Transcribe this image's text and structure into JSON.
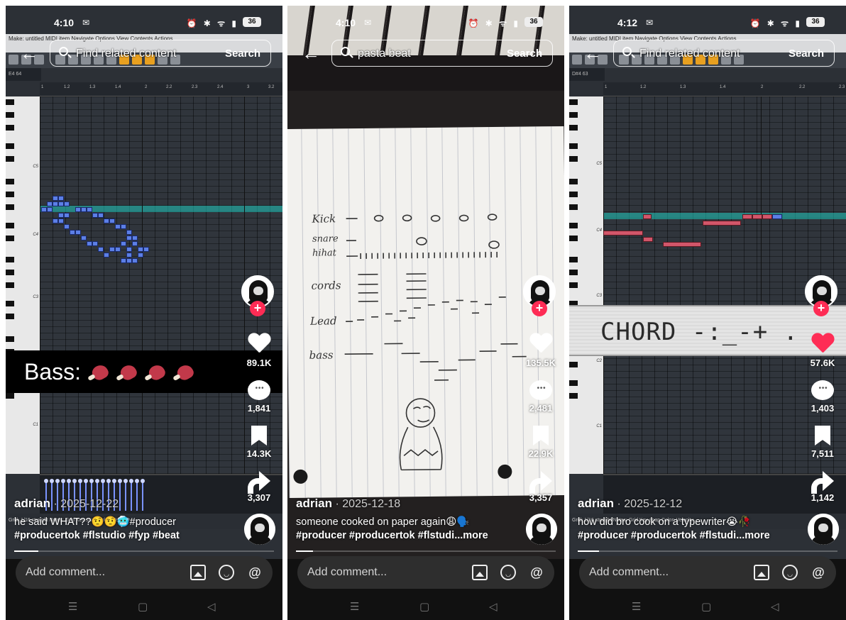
{
  "status_bar": [
    {
      "time": "4:10",
      "battery": "36"
    },
    {
      "time": "4:10",
      "battery": "36"
    },
    {
      "time": "4:12",
      "battery": "36"
    }
  ],
  "search": {
    "button_label": "Search",
    "queries": [
      "Find related content",
      "pasta beat",
      "Find related content"
    ]
  },
  "comment_bar": {
    "placeholder": "Add comment..."
  },
  "panel_1": {
    "app_menu": "Make: untitled MIDI item   Navigate   Options   View   Contents   Actions",
    "key_readout": "E4 64",
    "overlay_text": "Bass:",
    "likes": "89.1K",
    "comments": "1,841",
    "saves": "14.3K",
    "shares": "3,307",
    "username": "adrian",
    "date": "2025-12-22",
    "caption": "he said WHAT??🤨🤨🥶#producer",
    "tags": "#producertok #flstudio #fyp #beat",
    "status_text": "Grid: 1/16   straight   Notes: Grid   Key snap   Color: Velocity"
  },
  "panel_2": {
    "paper_labels": [
      "Kick",
      "snare",
      "hihat",
      "cords",
      "Lead",
      "bass"
    ],
    "likes": "135.5K",
    "comments": "2,481",
    "saves": "22.9K",
    "shares": "3,357",
    "username": "adrian",
    "date": "2025-12-18",
    "caption": "someone cooked on paper again😩🗣️",
    "tags": "#producer #producertok #flstudi",
    "more": "...more"
  },
  "panel_3": {
    "app_menu": "Make: untitled MIDI item   Navigate   Options   View   Contents   Actions",
    "key_readout": "D#4 63",
    "overlay_text": "CHORD -:_-+ .",
    "likes": "57.6K",
    "comments": "1,403",
    "saves": "7,511",
    "shares": "1,142",
    "username": "adrian",
    "date": "2025-12-12",
    "caption": "how did bro cook on a typewriter😭🥀",
    "tags": "#producer #producertok #flstudi",
    "more": "...more",
    "status_text": "Grid: 1/16   straight   Notes: Grid   Key snap   Color: Velocity"
  },
  "colors": {
    "like_active": "#fe2c55",
    "note_blue": "#5c7fe6",
    "note_red": "#d2566a",
    "highlight_row": "#20c8be"
  },
  "icons": [
    "back-arrow-icon",
    "search-icon",
    "heart-icon",
    "comment-icon",
    "bookmark-icon",
    "share-icon",
    "image-icon",
    "emoji-icon",
    "mention-icon"
  ]
}
